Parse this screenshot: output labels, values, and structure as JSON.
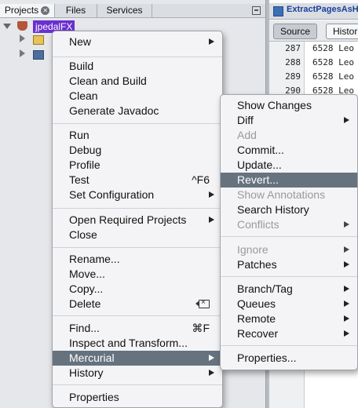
{
  "projects_panel": {
    "tabs": [
      {
        "label": "Projects",
        "active": true
      },
      {
        "label": "Files"
      },
      {
        "label": "Services"
      }
    ],
    "tree": {
      "project_name": "jpedalFX",
      "children": [
        "",
        ""
      ]
    }
  },
  "editor": {
    "tab_title": "ExtractPagesAsH",
    "source_button": "Source",
    "history_button": "Histor",
    "lines": [
      {
        "number": "287",
        "code": "6528 Leo"
      },
      {
        "number": "288",
        "code": "6528 Leo"
      },
      {
        "number": "289",
        "code": "6528 Leo"
      },
      {
        "number": "290",
        "code": "6528 Leo"
      }
    ]
  },
  "context_menu": {
    "items": [
      {
        "label": "New",
        "submenu": true
      },
      {
        "label": "Build"
      },
      {
        "label": "Clean and Build"
      },
      {
        "label": "Clean"
      },
      {
        "label": "Generate Javadoc"
      },
      {
        "label": "Run"
      },
      {
        "label": "Debug"
      },
      {
        "label": "Profile"
      },
      {
        "label": "Test",
        "shortcut": "^F6"
      },
      {
        "label": "Set Configuration",
        "submenu": true
      },
      {
        "label": "Open Required Projects",
        "submenu": true
      },
      {
        "label": "Close"
      },
      {
        "label": "Rename..."
      },
      {
        "label": "Move..."
      },
      {
        "label": "Copy..."
      },
      {
        "label": "Delete",
        "icon": "delete-key-icon"
      },
      {
        "label": "Find...",
        "shortcut": "⌘F"
      },
      {
        "label": "Inspect and Transform..."
      },
      {
        "label": "Mercurial",
        "submenu": true,
        "highlighted": true
      },
      {
        "label": "History",
        "submenu": true
      },
      {
        "label": "Properties"
      }
    ]
  },
  "mercurial_submenu": {
    "items": [
      {
        "label": "Show Changes"
      },
      {
        "label": "Diff",
        "submenu": true
      },
      {
        "label": "Add",
        "disabled": true
      },
      {
        "label": "Commit..."
      },
      {
        "label": "Update..."
      },
      {
        "label": "Revert...",
        "highlighted": true
      },
      {
        "label": "Show Annotations",
        "disabled": true
      },
      {
        "label": "Search History"
      },
      {
        "label": "Conflicts",
        "submenu": true,
        "disabled": true
      },
      {
        "label": "Ignore",
        "submenu": true,
        "disabled": true
      },
      {
        "label": "Patches",
        "submenu": true
      },
      {
        "label": "Branch/Tag",
        "submenu": true
      },
      {
        "label": "Queues",
        "submenu": true
      },
      {
        "label": "Remote",
        "submenu": true
      },
      {
        "label": "Recover",
        "submenu": true
      },
      {
        "label": "Properties..."
      }
    ]
  },
  "colors": {
    "menu_highlight": "#66737f",
    "project_selection": "#6a2fd1",
    "disabled_text": "#9a9a9e"
  }
}
